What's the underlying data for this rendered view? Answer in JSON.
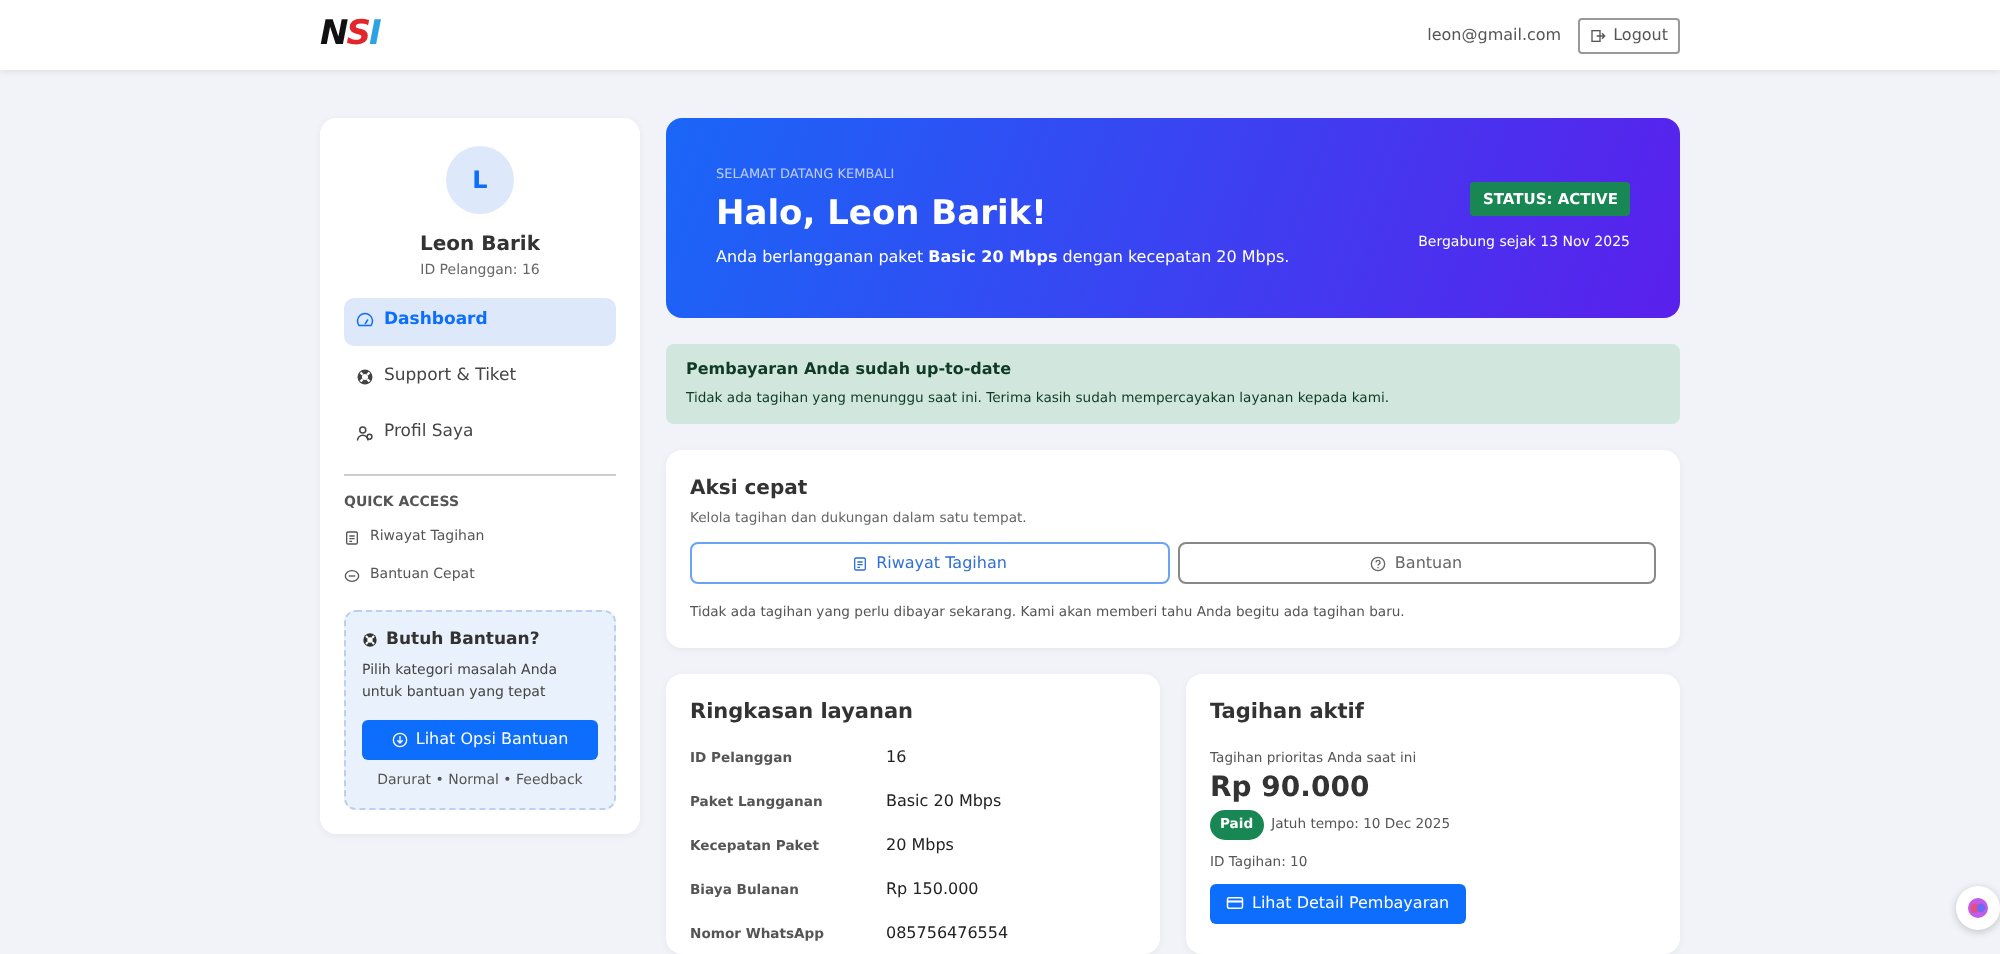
{
  "navbar": {
    "logo": "NSI",
    "email": "leon@gmail.com",
    "logout": "Logout"
  },
  "sidebar": {
    "avatar": "L",
    "name": "Leon Barik",
    "customer_id": "ID Pelanggan: 16",
    "items": [
      {
        "label": "Dashboard",
        "selected": true
      },
      {
        "label": "Support & Tiket",
        "selected": false
      },
      {
        "label": "Profil Saya",
        "selected": false
      }
    ],
    "quick_access": {
      "heading": "QUICK ACCESS",
      "items": [
        {
          "label": "Riwayat Tagihan"
        },
        {
          "label": "Bantuan Cepat"
        }
      ]
    },
    "help": {
      "title": "Butuh Bantuan?",
      "text": "Pilih kategori masalah Anda untuk bantuan yang tepat",
      "button": "Lihat Opsi Bantuan",
      "footer": "Darurat • Normal • Feedback"
    }
  },
  "hero": {
    "eyebrow": "SELAMAT DATANG KEMBALI",
    "title": "Halo, Leon Barik!",
    "text": "Anda berlangganan paket **Basic 20 Mbps** dengan kecepatan 20 Mbps.",
    "status": "STATUS: ACTIVE",
    "joined": "Bergabung sejak 13 Nov 2025"
  },
  "alert": {
    "title": "Pembayaran Anda sudah up-to-date",
    "text": "Tidak ada tagihan yang menunggu saat ini. Terima kasih sudah mempercayakan layanan kepada kami."
  },
  "quick_actions": {
    "title": "Aksi cepat",
    "subtitle": "Kelola tagihan dan dukungan dalam satu tempat.",
    "buttons": [
      {
        "label": "Riwayat Tagihan",
        "kind": "primary"
      },
      {
        "label": "Bantuan",
        "kind": "secondary"
      }
    ],
    "note": "Tidak ada tagihan yang perlu dibayar sekarang. Kami akan memberi tahu Anda begitu ada tagihan baru."
  },
  "summary": {
    "title": "Ringkasan layanan",
    "rows": [
      {
        "label": "ID Pelanggan",
        "value": "16"
      },
      {
        "label": "Paket Langganan",
        "value": "Basic 20 Mbps"
      },
      {
        "label": "Kecepatan Paket",
        "value": "20 Mbps"
      },
      {
        "label": "Biaya Bulanan",
        "value": "Rp 150.000"
      },
      {
        "label": "Nomor WhatsApp",
        "value": "085756476554"
      }
    ]
  },
  "active_bill": {
    "title": "Tagihan aktif",
    "subtitle": "Tagihan prioritas Anda saat ini",
    "amount": "Rp 90.000",
    "status": "Paid",
    "due": "Jatuh tempo: 10 Dec 2025",
    "bill_id": "ID Tagihan: 10",
    "button": "Lihat Detail Pembayaran"
  }
}
